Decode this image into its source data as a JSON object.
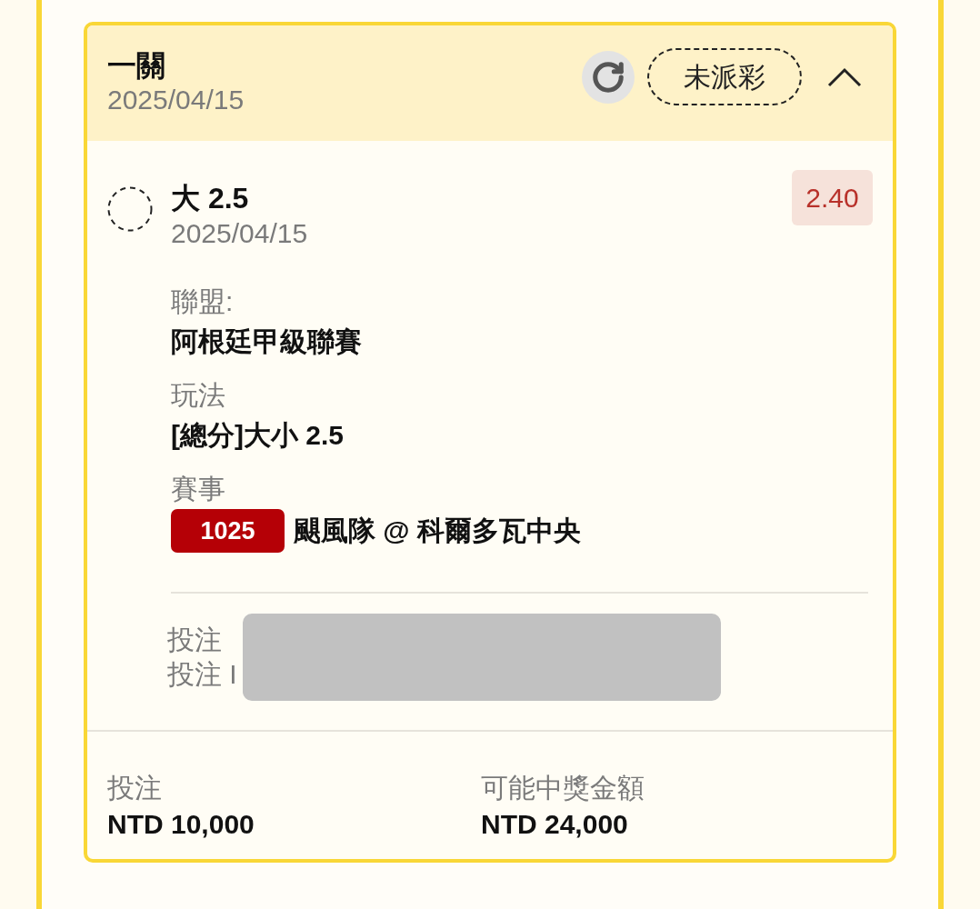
{
  "bet_card": {
    "title": "一關",
    "date": "2025/04/15",
    "status": "未派彩",
    "expanded": true
  },
  "selection": {
    "name": "大 2.5",
    "date": "2025/04/15",
    "odds": "2.40"
  },
  "details": [
    {
      "kind": "text",
      "label": "聯盟:",
      "value": "阿根廷甲級聯賽"
    },
    {
      "kind": "text",
      "label": "玩法",
      "value": "[總分]大小 2.5"
    },
    {
      "kind": "match",
      "label": "賽事",
      "code": "1025",
      "value": "颶風隊 @ 科爾多瓦中央"
    }
  ],
  "bet_info": [
    "投注",
    "投注 I"
  ],
  "summary": [
    {
      "label": "投注",
      "value": "NTD 10,000"
    },
    {
      "label": "可能中獎金額",
      "value": "NTD 24,000"
    }
  ]
}
